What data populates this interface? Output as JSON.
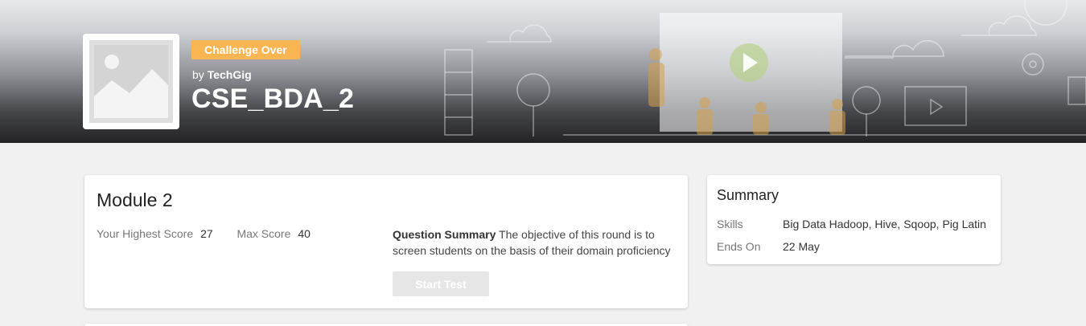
{
  "header": {
    "status_badge": "Challenge Over",
    "by_prefix": "by",
    "organizer": "TechGig",
    "challenge_title": "CSE_BDA_2"
  },
  "module": {
    "title": "Module 2",
    "highest_score_label": "Your Highest Score",
    "highest_score_value": "27",
    "max_score_label": "Max Score",
    "max_score_value": "40",
    "question_summary_label": "Question Summary",
    "question_summary_text": "The objective of this round is to screen students on the basis of their domain proficiency",
    "start_button_label": "Start Test"
  },
  "summary": {
    "title": "Summary",
    "skills_label": "Skills",
    "skills_value": "Big Data Hadoop, Hive, Sqoop, Pig Latin",
    "ends_on_label": "Ends On",
    "ends_on_value": "22 May"
  },
  "colors": {
    "badge": "#f8b552",
    "page_background": "#f1f1f1",
    "button_disabled": "#e6e6e6"
  },
  "icons": {
    "thumbnail": "image-placeholder-icon",
    "video": "play-icon"
  }
}
